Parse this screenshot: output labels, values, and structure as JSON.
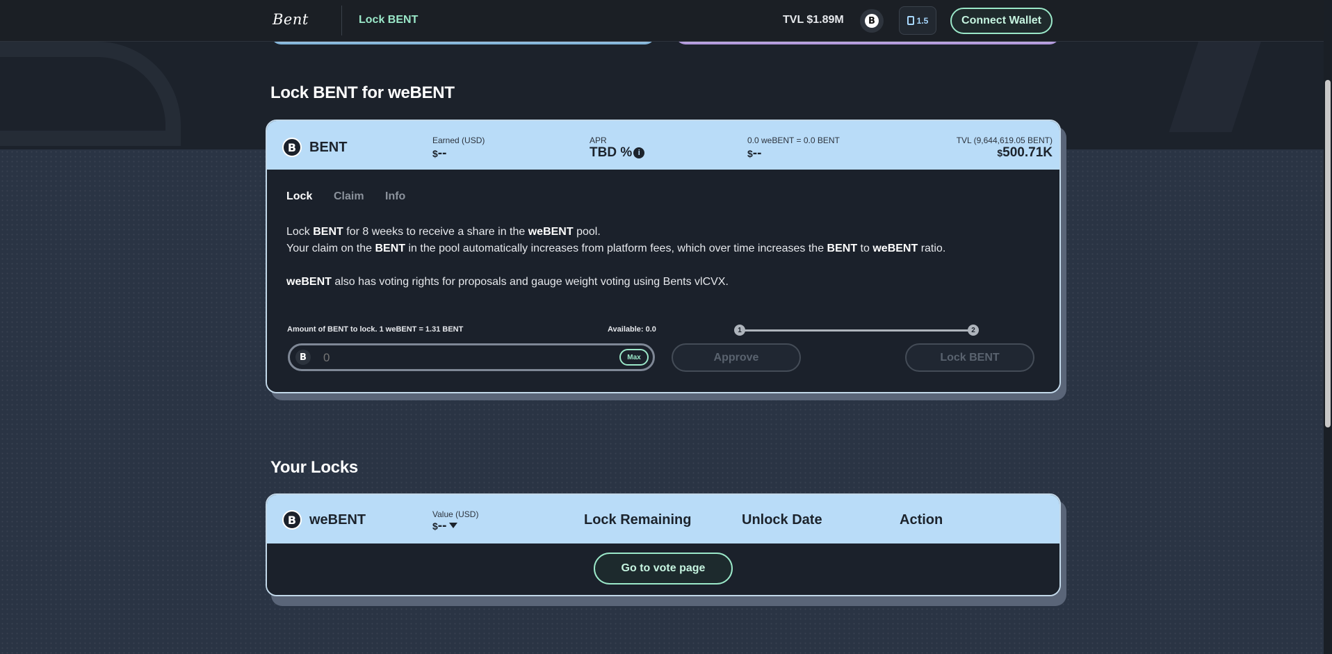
{
  "header": {
    "logo": "Bent",
    "nav_active": "Lock BENT",
    "tvl": "TVL $1.89M",
    "gas": "1.5",
    "connect_wallet": "Connect Wallet"
  },
  "lock_section": {
    "title": "Lock BENT for weBENT",
    "token_name": "BENT",
    "earned_label": "Earned (USD)",
    "earned_value_prefix": "$",
    "earned_value": "--",
    "apr_label": "APR",
    "apr_value": "TBD %",
    "ratio_label": "0.0 weBENT = 0.0 BENT",
    "ratio_value_prefix": "$",
    "ratio_value": "--",
    "tvl_label": "TVL (9,644,619.05 BENT)",
    "tvl_value_prefix": "$",
    "tvl_value": "500.71K",
    "tabs": [
      "Lock",
      "Claim",
      "Info"
    ],
    "description": {
      "line1_a": "Lock ",
      "line1_b": "BENT",
      "line1_c": " for 8 weeks to receive a share in the ",
      "line1_d": "weBENT",
      "line1_e": " pool.",
      "line2_a": "Your claim on the ",
      "line2_b": "BENT",
      "line2_c": " in the pool automatically increases from platform fees, which over time increases the ",
      "line2_d": "BENT",
      "line2_e": " to ",
      "line2_f": "weBENT",
      "line2_g": " ratio.",
      "line3_a": "weBENT",
      "line3_b": " also has voting rights for proposals and gauge weight voting using Bents vlCVX."
    },
    "amount_label": "Amount of BENT to lock. 1 weBENT = 1.31 BENT",
    "available": "Available: 0.0",
    "amount_placeholder": "0",
    "max_label": "Max",
    "step1": "1",
    "step2": "2",
    "approve_label": "Approve",
    "lock_label": "Lock BENT"
  },
  "locks_section": {
    "title": "Your Locks",
    "token_name": "weBENT",
    "value_label": "Value (USD)",
    "value_prefix": "$",
    "value": "--",
    "col_lock_remaining": "Lock Remaining",
    "col_unlock_date": "Unlock Date",
    "col_action": "Action",
    "vote_button": "Go to vote page"
  },
  "colors": {
    "accent_green": "#9be8c9",
    "card_head_blue": "#b9dcf8",
    "card_body": "#1b212b"
  }
}
